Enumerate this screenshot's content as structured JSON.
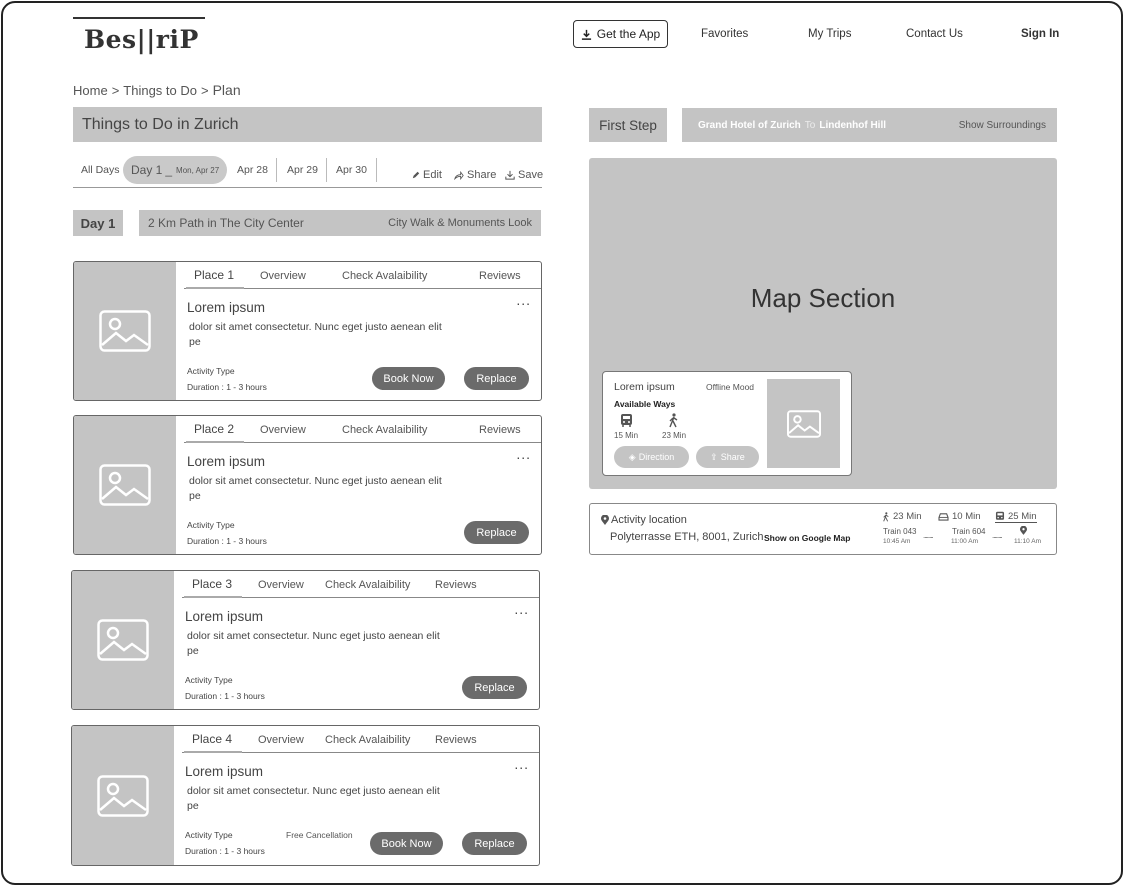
{
  "header": {
    "logo": "Bes||riP",
    "get_app": "Get the App",
    "nav": [
      "Favorites",
      "My Trips",
      "Contact Us"
    ],
    "sign_in": "Sign In"
  },
  "breadcrumb": {
    "home": "Home",
    "sep": ">",
    "things": "Things to Do",
    "plan": "Plan"
  },
  "page_title": "Things to Do in Zurich",
  "day_tabs": {
    "all": "All Days",
    "selected_label": "Day 1",
    "selected_dash": "_",
    "selected_date": "Mon, Apr 27",
    "others": [
      "Apr 28",
      "Apr 29",
      "Apr 30"
    ]
  },
  "actions": {
    "edit": "Edit",
    "share": "Share",
    "save": "Save"
  },
  "day": {
    "label": "Day 1",
    "path": "2 Km Path in The City Center",
    "theme": "City Walk & Monuments Look"
  },
  "card_tabs": {
    "overview": "Overview",
    "check": "Check Avalaibility",
    "reviews": "Reviews"
  },
  "places": [
    {
      "tab": "Place 1",
      "name": "Lorem ipsum",
      "desc": "dolor sit amet consectetur. Nunc eget justo aenean elit pe",
      "activity": "Activity Type",
      "duration": "Duration : 1 - 3 hours",
      "free": "",
      "book": "Book Now",
      "replace": "Replace"
    },
    {
      "tab": "Place 2",
      "name": "Lorem ipsum",
      "desc": "dolor sit amet consectetur. Nunc eget justo aenean elit pe",
      "activity": "Activity Type",
      "duration": "Duration : 1 - 3 hours",
      "free": "",
      "book": "",
      "replace": "Replace"
    },
    {
      "tab": "Place 3",
      "name": "Lorem ipsum",
      "desc": "dolor sit amet consectetur. Nunc eget justo aenean elit pe",
      "activity": "Activity Type",
      "duration": "Duration : 1 - 3 hours",
      "free": "",
      "book": "",
      "replace": "Replace"
    },
    {
      "tab": "Place 4",
      "name": "Lorem ipsum",
      "desc": "dolor sit amet consectetur. Nunc eget justo aenean elit pe",
      "activity": "Activity Type",
      "duration": "Duration : 1 - 3 hours",
      "free": "Free Cancellation",
      "book": "Book Now",
      "replace": "Replace"
    }
  ],
  "more": "...",
  "route": {
    "step": "First Step",
    "from": "Grand Hotel of Zurich",
    "to_word": "To",
    "to": "Lindenhof Hill",
    "surroundings": "Show Surroundings"
  },
  "map": {
    "title": "Map Section",
    "card": {
      "name": "Lorem ipsum",
      "mode": "Offline Mood",
      "ways": "Available Ways",
      "bus_time": "15 Min",
      "walk_time": "23 Min",
      "direction": "Direction",
      "share": "Share"
    }
  },
  "location": {
    "label": "Activity location",
    "address": "Polyterrasse ETH, 8001, Zurich",
    "google": "Show on Google Map",
    "walk": "23 Min",
    "car": "10 Min",
    "train": "25 Min",
    "train1": "Train 043",
    "train2": "Train 604",
    "dots": "........",
    "t1": "10:45 Am",
    "t2": "11:00 Am",
    "t3": "11:10 Am"
  },
  "colors": {
    "panel": "#c4c4c4",
    "button": "#6b6b6b",
    "border": "#222222"
  }
}
